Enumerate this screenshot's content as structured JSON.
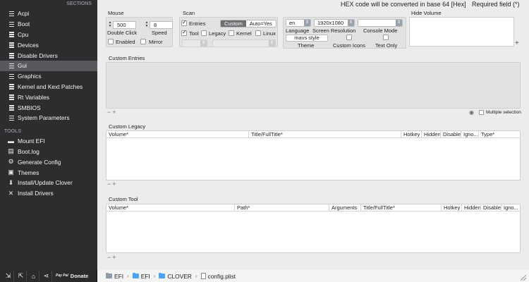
{
  "sidebar": {
    "sections_header": "SECTIONS",
    "sections": [
      "Acpi",
      "Boot",
      "Cpu",
      "Devices",
      "Disable Drivers",
      "Gui",
      "Graphics",
      "Kernel and Kext Patches",
      "Rt Variables",
      "SMBIOS",
      "System Parameters"
    ],
    "active_section": "Gui",
    "tools_header": "TOOLS",
    "tools": [
      {
        "label": "Mount EFI",
        "icon": "disk-icon"
      },
      {
        "label": "Boot.log",
        "icon": "log-icon"
      },
      {
        "label": "Generate Config",
        "icon": "gear-icon"
      },
      {
        "label": "Themes",
        "icon": "themes-icon"
      },
      {
        "label": "Install/Update Clover",
        "icon": "download-icon"
      },
      {
        "label": "Install Drivers",
        "icon": "wrench-icon"
      }
    ]
  },
  "bottombar": {
    "buttons": [
      {
        "name": "import-icon",
        "glyph": "⇲"
      },
      {
        "name": "export-icon",
        "glyph": "⇱"
      },
      {
        "name": "home-icon",
        "glyph": "⌂"
      },
      {
        "name": "share-icon",
        "glyph": "⋖"
      }
    ],
    "paypal_text": "Pay Pal",
    "donate_label": "Donate",
    "path": [
      "EFI",
      "EFI",
      "CLOVER",
      "config.plist"
    ]
  },
  "header": {
    "hex_note": "HEX code will be converted in base 64 [Hex]",
    "required_note": "Required field (*)"
  },
  "mouse": {
    "label": "Mouse",
    "double_click_value": "500",
    "double_click_label": "Double Click",
    "speed_value": "8",
    "speed_label": "Speed",
    "enabled_label": "Enabled",
    "mirror_label": "Mirror"
  },
  "scan": {
    "label": "Scan",
    "entries_label": "Entries",
    "custom_label": "Custom",
    "auto_label": "Auto=Yes",
    "tool_label": "Tool",
    "legacy_label": "Legacy",
    "kernel_label": "Kernel",
    "linux_label": "Linux"
  },
  "appearance": {
    "language_value": "en",
    "language_label": "Language",
    "resolution_value": "1920x1080",
    "resolution_label": "Screen Resolution",
    "console_label": "Console Mode",
    "theme_value": "mavs style",
    "theme_label": "Theme",
    "custom_icons_label": "Custom Icons",
    "text_only_label": "Text Only"
  },
  "hide_volume": {
    "label": "Hide Volume"
  },
  "custom_entries": {
    "label": "Custom Entries",
    "multiple_selection_label": "Multiple selection"
  },
  "custom_legacy": {
    "label": "Custom Legacy",
    "columns": [
      "Volume*",
      "Title/FullTitle*",
      "Hotkey",
      "Hidden",
      "Disable",
      "Igno...",
      "Type*"
    ]
  },
  "custom_tool": {
    "label": "Custom Tool",
    "columns": [
      "Volume*",
      "Path*",
      "Arguments",
      "Title/FullTitle*",
      "Hotkey",
      "Hidden",
      "Disable",
      "Igno..."
    ]
  },
  "colors": {
    "sidebar_bg": "#2d2d2f",
    "sidebar_active": "#59595d",
    "accent_folder": "#4da3f5",
    "segment_selected": "#6e6e73"
  }
}
